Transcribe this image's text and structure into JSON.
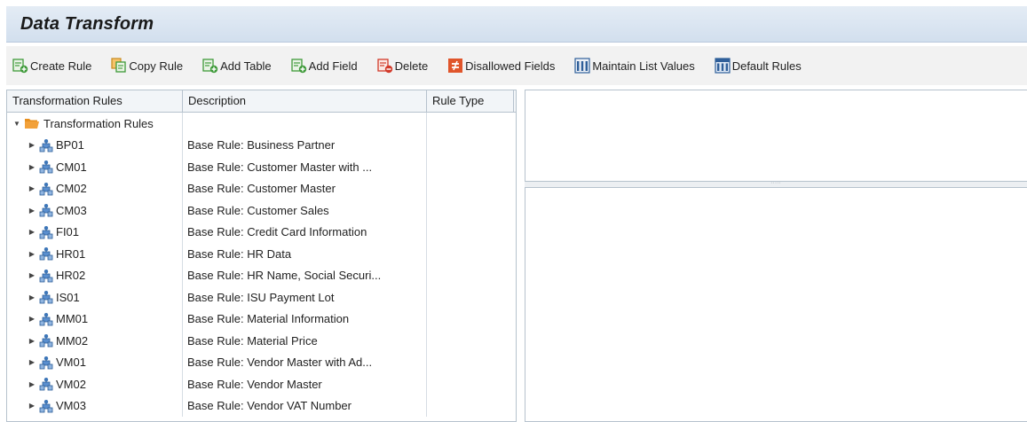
{
  "header": {
    "title": "Data Transform"
  },
  "toolbar": {
    "create_rule": "Create Rule",
    "copy_rule": "Copy Rule",
    "add_table": "Add Table",
    "add_field": "Add Field",
    "delete": "Delete",
    "disallowed_fields": "Disallowed Fields",
    "maintain_list_values": "Maintain List Values",
    "default_rules": "Default Rules"
  },
  "grid": {
    "columns": [
      "Transformation Rules",
      "Description",
      "Rule Type"
    ],
    "root": {
      "label": "Transformation Rules",
      "expanded": true
    },
    "rows": [
      {
        "id": "BP01",
        "description": "Base Rule: Business Partner",
        "rule_type": ""
      },
      {
        "id": "CM01",
        "description": "Base Rule: Customer Master with ...",
        "rule_type": ""
      },
      {
        "id": "CM02",
        "description": "Base Rule: Customer Master",
        "rule_type": ""
      },
      {
        "id": "CM03",
        "description": "Base Rule: Customer Sales",
        "rule_type": ""
      },
      {
        "id": "FI01",
        "description": "Base Rule: Credit Card Information",
        "rule_type": ""
      },
      {
        "id": "HR01",
        "description": "Base Rule: HR Data",
        "rule_type": ""
      },
      {
        "id": "HR02",
        "description": "Base Rule: HR Name, Social Securi...",
        "rule_type": ""
      },
      {
        "id": "IS01",
        "description": "Base Rule: ISU Payment Lot",
        "rule_type": ""
      },
      {
        "id": "MM01",
        "description": "Base Rule: Material Information",
        "rule_type": ""
      },
      {
        "id": "MM02",
        "description": "Base Rule: Material Price",
        "rule_type": ""
      },
      {
        "id": "VM01",
        "description": "Base Rule: Vendor Master with Ad...",
        "rule_type": ""
      },
      {
        "id": "VM02",
        "description": "Base Rule: Vendor Master",
        "rule_type": ""
      },
      {
        "id": "VM03",
        "description": "Base Rule: Vendor VAT Number",
        "rule_type": ""
      }
    ]
  },
  "icons": {
    "create_rule": "document-add-icon",
    "copy_rule": "copy-icon",
    "add_table": "table-add-icon",
    "add_field": "field-add-icon",
    "delete": "document-delete-icon",
    "disallowed_fields": "not-equal-icon",
    "maintain_list_values": "list-values-icon",
    "default_rules": "default-rules-icon",
    "root": "folder-open-icon",
    "rule": "rule-node-icon"
  },
  "colors": {
    "title_bar": "#d9e4f0",
    "toolbar": "#f2f2f2",
    "add_green": "#3f9a3a",
    "delete_red": "#d23a2a",
    "disallowed_orange": "#e0552b",
    "folder_orange": "#f2a13a",
    "node_blue": "#3d76b8"
  }
}
